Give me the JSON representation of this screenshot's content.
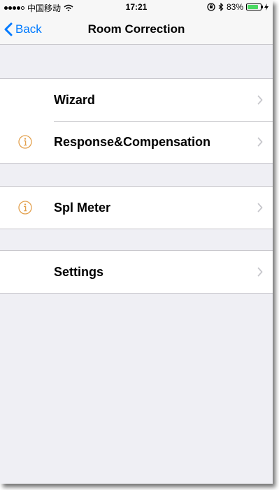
{
  "status_bar": {
    "carrier": "中国移动",
    "time": "17:21",
    "battery_percent": "83%",
    "battery_level": 0.83,
    "icons": [
      "signal-dots",
      "wifi-icon",
      "rotation-lock-icon",
      "bluetooth-icon",
      "battery-icon",
      "charging-icon"
    ]
  },
  "nav": {
    "back_label": "Back",
    "title": "Room Correction"
  },
  "groups": [
    {
      "rows": [
        {
          "label": "Wizard",
          "info_icon": false
        },
        {
          "label": "Response&Compensation",
          "info_icon": true
        }
      ]
    },
    {
      "rows": [
        {
          "label": "Spl Meter",
          "info_icon": true
        }
      ]
    },
    {
      "rows": [
        {
          "label": "Settings",
          "info_icon": false
        }
      ]
    }
  ],
  "colors": {
    "accent": "#007aff",
    "info_icon": "#e3a14f",
    "background": "#efeff4",
    "separator": "#c8c7cc",
    "chevron": "#c7c7cc",
    "battery": "#4cd964"
  }
}
